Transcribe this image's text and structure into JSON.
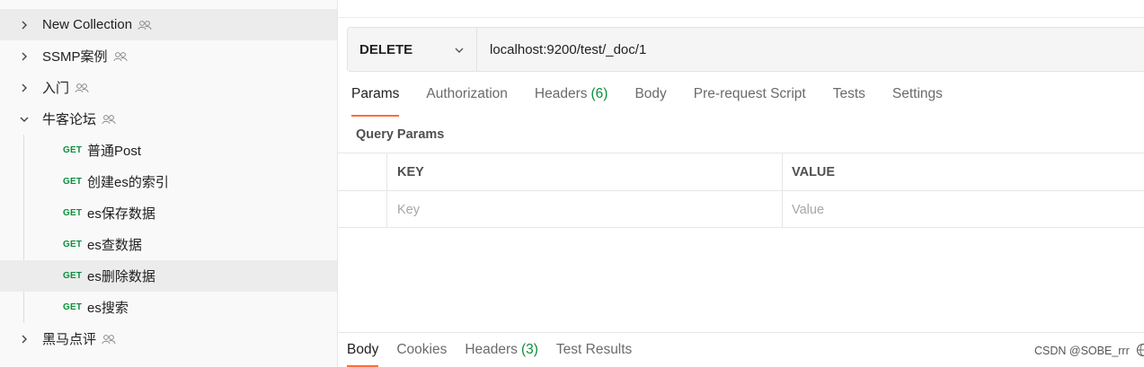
{
  "sidebar": {
    "items": [
      {
        "type": "collection",
        "label": "New Collection",
        "expanded": false,
        "shared": true,
        "selected": true,
        "chevron_icon": "chevron-right-icon"
      },
      {
        "type": "collection",
        "label": "SSMP案例",
        "expanded": false,
        "shared": true,
        "chevron_icon": "chevron-right-icon"
      },
      {
        "type": "collection",
        "label": "入门",
        "expanded": false,
        "shared": true,
        "chevron_icon": "chevron-right-icon"
      },
      {
        "type": "collection",
        "label": "牛客论坛",
        "expanded": true,
        "shared": true,
        "chevron_icon": "chevron-down-icon"
      },
      {
        "type": "request",
        "method": "GET",
        "label": "普通Post"
      },
      {
        "type": "request",
        "method": "GET",
        "label": "创建es的索引"
      },
      {
        "type": "request",
        "method": "GET",
        "label": "es保存数据"
      },
      {
        "type": "request",
        "method": "GET",
        "label": "es查数据"
      },
      {
        "type": "request",
        "method": "GET",
        "label": "es删除数据",
        "selected": true
      },
      {
        "type": "request",
        "method": "GET",
        "label": "es搜索"
      },
      {
        "type": "collection",
        "label": "黑马点评",
        "expanded": false,
        "shared": true,
        "chevron_icon": "chevron-right-icon"
      }
    ]
  },
  "request": {
    "method": "DELETE",
    "url": "localhost:9200/test/_doc/1"
  },
  "tabs": [
    {
      "label": "Params",
      "active": true
    },
    {
      "label": "Authorization"
    },
    {
      "label": "Headers",
      "count": "(6)"
    },
    {
      "label": "Body"
    },
    {
      "label": "Pre-request Script"
    },
    {
      "label": "Tests"
    },
    {
      "label": "Settings"
    }
  ],
  "query_params": {
    "title": "Query Params",
    "columns": [
      "KEY",
      "VALUE"
    ],
    "key_placeholder": "Key",
    "value_placeholder": "Value"
  },
  "response_tabs": [
    {
      "label": "Body",
      "active": true
    },
    {
      "label": "Cookies"
    },
    {
      "label": "Headers",
      "count": "(3)"
    },
    {
      "label": "Test Results"
    }
  ],
  "watermark": "CSDN @SOBE_rrr",
  "colors": {
    "accent": "#ff6c37",
    "method_get": "#0a8f3b",
    "count": "#0a8f3b"
  }
}
